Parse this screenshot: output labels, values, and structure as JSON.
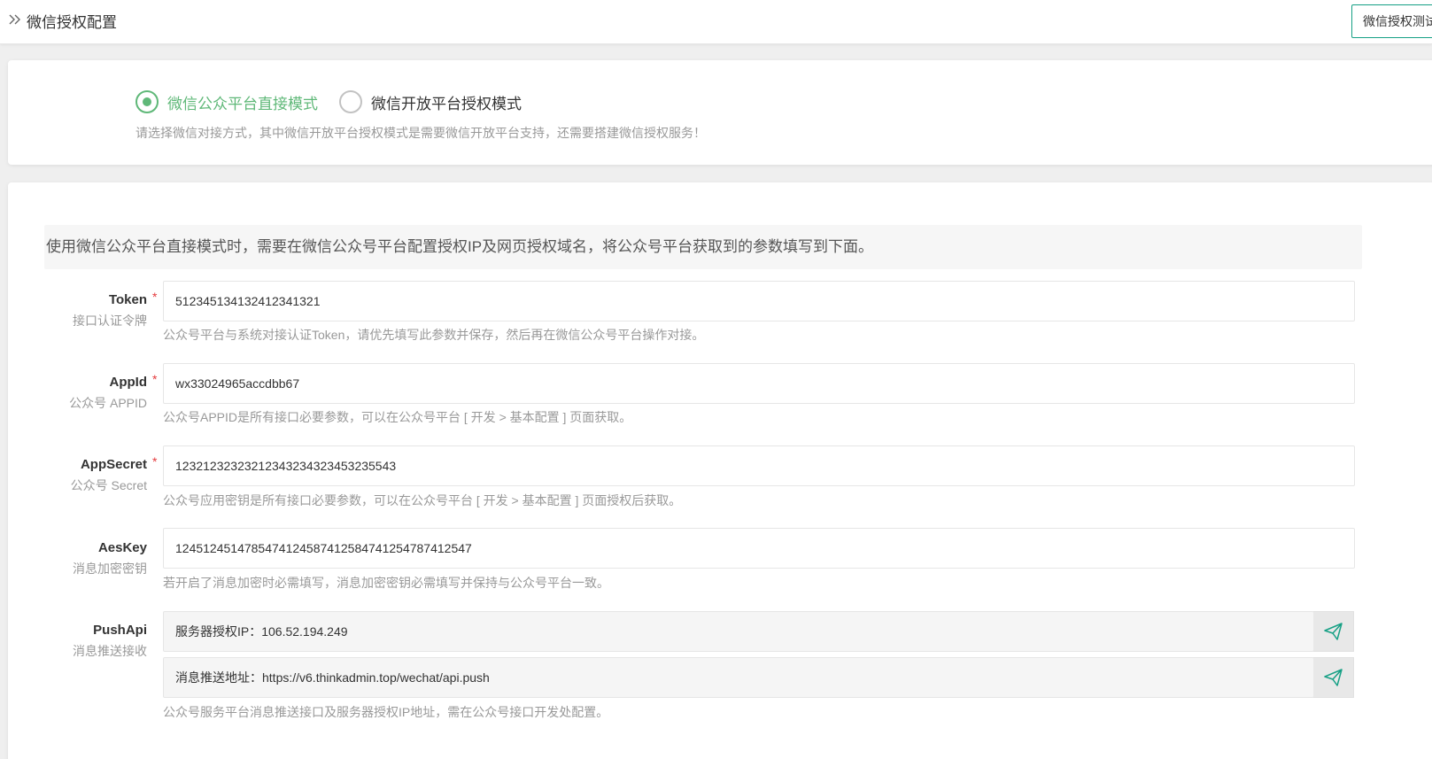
{
  "header": {
    "title": "微信授权配置",
    "test_button": "微信授权测试"
  },
  "mode": {
    "options": [
      {
        "label": "微信公众平台直接模式",
        "checked": true
      },
      {
        "label": "微信开放平台授权模式",
        "checked": false
      }
    ],
    "help": "请选择微信对接方式，其中微信开放平台授权模式是需要微信开放平台支持，还需要搭建微信授权服务！"
  },
  "config": {
    "notice": "使用微信公众平台直接模式时，需要在微信公众号平台配置授权IP及网页授权域名，将公众号平台获取到的参数填写到下面。",
    "required_mark": "*",
    "fields": [
      {
        "label": "Token",
        "sub": "接口认证令牌",
        "value": "5123451341324123413​21",
        "help": "公众号平台与系统对接认证Token，请优先填写此参数并保存，然后再在微信公众号平台操作对接。"
      },
      {
        "label": "AppId",
        "sub": "公众号 APPID",
        "value": "wx33024965accdbb67",
        "help": "公众号APPID是所有接口必要参数，可以在公众号平台 [ 开发 > 基本配置 ] 页面获取。"
      },
      {
        "label": "AppSecret",
        "sub": "公众号 Secret",
        "value": "1232123232321234323432345323​5543",
        "help": "公众号应用密钥是所有接口必要参数，可以在公众号平台 [ 开发 > 基本配置 ] 页面授权后获取。"
      },
      {
        "label": "AesKey",
        "sub": "消息加密密钥",
        "value": "1245124514785474124587412584741254787412547",
        "help": "若开启了消息加密时必需填写，消息加密密钥必需填写并保持与公众号平台一致。"
      }
    ],
    "push": {
      "label": "PushApi",
      "sub": "消息推送接收",
      "server_ip": "服务器授权IP：106.52.194.249",
      "push_url": "消息推送地址：https://v6.thinkadmin.top/wechat/api.push",
      "help": "公众号服务平台消息推送接口及服务器授权IP地址，需在公众号接口开发处配置。"
    }
  },
  "colors": {
    "accent": "#5fb878",
    "button_border": "#16a085",
    "required": "#e4393c"
  }
}
